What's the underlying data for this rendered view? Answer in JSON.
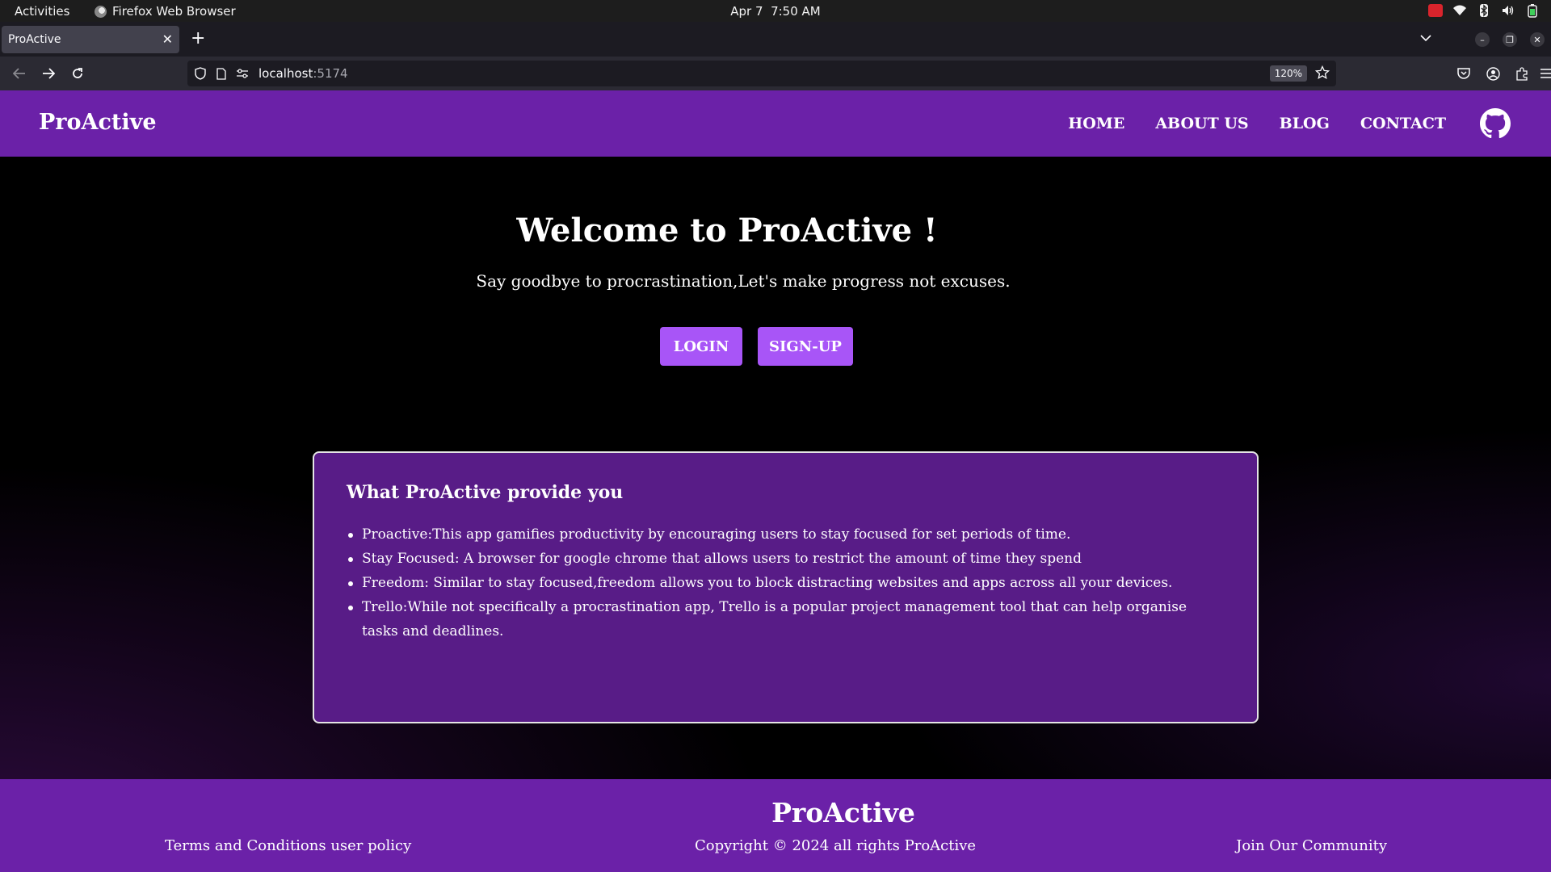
{
  "system": {
    "activities": "Activities",
    "app_name": "Firefox Web Browser",
    "date": "Apr 7",
    "time": "7:50 AM"
  },
  "browser": {
    "tab_title": "ProActive",
    "url_host": "localhost",
    "url_port": ":5174",
    "zoom": "120%"
  },
  "site": {
    "brand": "ProActive",
    "nav": [
      "HOME",
      "ABOUT US",
      "BLOG",
      "CONTACT"
    ],
    "hero": {
      "title": "Welcome to ProActive !",
      "subtitle": "Say goodbye to procrastination,Let's make progress not excuses.",
      "login_label": "LOGIN",
      "signup_label": "SIGN-UP"
    },
    "card": {
      "heading": "What ProActive provide you",
      "items": [
        "Proactive:This app gamifies productivity by encouraging users to stay focused for set periods of time.",
        "Stay Focused: A browser for google chrome that allows users to restrict the amount of time they spend",
        "Freedom: Similar to stay focused,freedom allows you to block distracting websites and apps across all your devices.",
        "Trello:While not specifically a procrastination app, Trello is a popular project management tool that can help organise tasks and deadlines."
      ]
    },
    "footer": {
      "brand": "ProActive",
      "terms": "Terms and Conditions user policy",
      "copyright": "Copyright © 2024 all rights ProActive",
      "community": "Join Our Community"
    }
  },
  "colors": {
    "header_purple": "#6b21a8",
    "button_purple": "#a855f7",
    "card_purple": "#581c87"
  }
}
